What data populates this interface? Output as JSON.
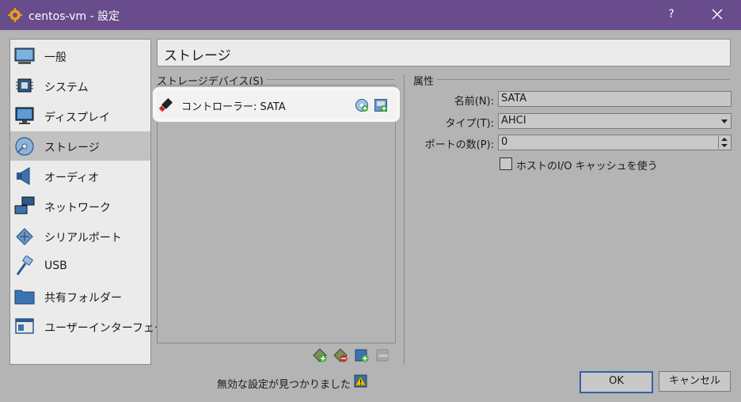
{
  "window": {
    "title": "centos-vm - 設定",
    "help_label": "?"
  },
  "sidebar": {
    "items": [
      {
        "label": "一般",
        "icon": "general-icon"
      },
      {
        "label": "システム",
        "icon": "system-icon"
      },
      {
        "label": "ディスプレイ",
        "icon": "display-icon"
      },
      {
        "label": "ストレージ",
        "icon": "storage-icon",
        "selected": true
      },
      {
        "label": "オーディオ",
        "icon": "audio-icon"
      },
      {
        "label": "ネットワーク",
        "icon": "network-icon"
      },
      {
        "label": "シリアルポート",
        "icon": "serial-port-icon"
      },
      {
        "label": "USB",
        "icon": "usb-icon"
      },
      {
        "label": "共有フォルダー",
        "icon": "shared-folder-icon"
      },
      {
        "label": "ユーザーインターフェース",
        "icon": "user-interface-icon"
      }
    ]
  },
  "page": {
    "title": "ストレージ"
  },
  "storage_devices": {
    "label": "ストレージデバイス(S)",
    "controller": {
      "label": "コントローラー: SATA"
    }
  },
  "attributes": {
    "label": "属性",
    "name": {
      "label": "名前(N):",
      "value": "SATA"
    },
    "type": {
      "label": "タイプ(T):",
      "value": "AHCI"
    },
    "ports": {
      "label": "ポートの数(P):",
      "value": "0"
    },
    "host_io_cache": {
      "label": "ホストのI/O キャッシュを使う",
      "checked": false
    }
  },
  "status": {
    "text": "無効な設定が見つかりました"
  },
  "buttons": {
    "ok": "OK",
    "cancel": "キャンセル"
  },
  "colors": {
    "titlebar": "#684c8c",
    "background": "#b4b4b4",
    "panel": "#ebebeb",
    "selected": "#c2c2c2",
    "accent": "#2f63a8"
  }
}
